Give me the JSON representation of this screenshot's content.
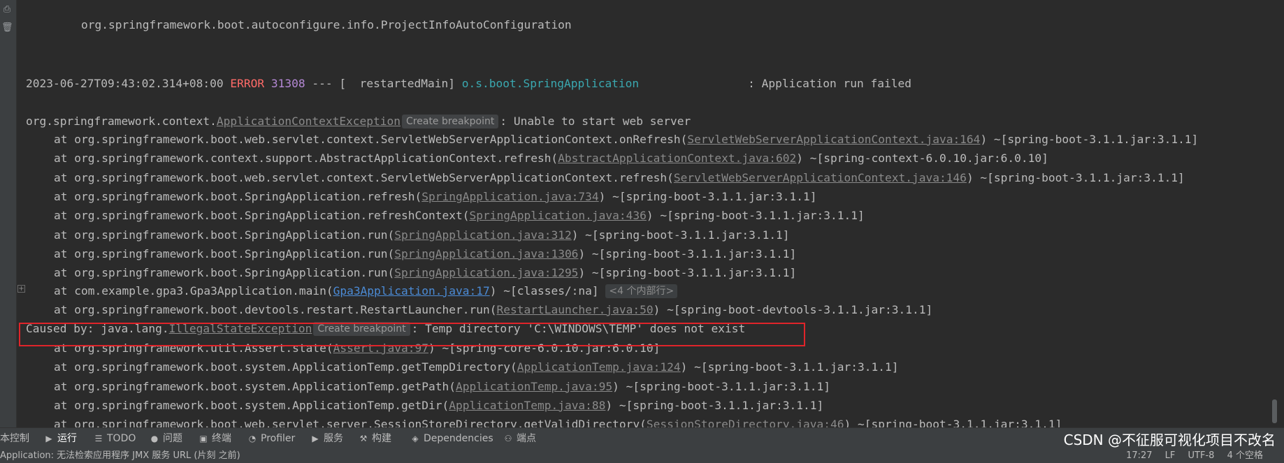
{
  "console": {
    "line_top": "org.springframework.boot.autoconfigure.info.ProjectInfoAutoConfiguration",
    "log": {
      "timestamp": "2023-06-27T09:43:02.314+08:00",
      "level": "ERROR",
      "pid": "31308",
      "sep": "--- [",
      "thread": "  restartedMain]",
      "logger": "o.s.boot.SpringApplication",
      "message": ": Application run failed"
    },
    "exception": {
      "prefix": "org.springframework.context.",
      "class": "ApplicationContextException",
      "breakpoint": "Create breakpoint",
      "message": ": Unable to start web server"
    },
    "trace1": [
      {
        "pre": "at org.springframework.boot.web.servlet.context.ServletWebServerApplicationContext.onRefresh(",
        "link": "ServletWebServerApplicationContext.java:164",
        "post": ") ~[spring-boot-3.1.1.jar:3.1.1]"
      },
      {
        "pre": "at org.springframework.context.support.AbstractApplicationContext.refresh(",
        "link": "AbstractApplicationContext.java:602",
        "post": ") ~[spring-context-6.0.10.jar:6.0.10]"
      },
      {
        "pre": "at org.springframework.boot.web.servlet.context.ServletWebServerApplicationContext.refresh(",
        "link": "ServletWebServerApplicationContext.java:146",
        "post": ") ~[spring-boot-3.1.1.jar:3.1.1]"
      },
      {
        "pre": "at org.springframework.boot.SpringApplication.refresh(",
        "link": "SpringApplication.java:734",
        "post": ") ~[spring-boot-3.1.1.jar:3.1.1]"
      },
      {
        "pre": "at org.springframework.boot.SpringApplication.refreshContext(",
        "link": "SpringApplication.java:436",
        "post": ") ~[spring-boot-3.1.1.jar:3.1.1]"
      },
      {
        "pre": "at org.springframework.boot.SpringApplication.run(",
        "link": "SpringApplication.java:312",
        "post": ") ~[spring-boot-3.1.1.jar:3.1.1]"
      },
      {
        "pre": "at org.springframework.boot.SpringApplication.run(",
        "link": "SpringApplication.java:1306",
        "post": ") ~[spring-boot-3.1.1.jar:3.1.1]"
      },
      {
        "pre": "at org.springframework.boot.SpringApplication.run(",
        "link": "SpringApplication.java:1295",
        "post": ") ~[spring-boot-3.1.1.jar:3.1.1]"
      }
    ],
    "main_line": {
      "pre": "at com.example.gpa3.Gpa3Application.main(",
      "link": "Gpa3Application.java:17",
      "post": ") ~[classes/:na] ",
      "hint": "<4 个内部行>"
    },
    "restart_line": {
      "pre": "at org.springframework.boot.devtools.restart.RestartLauncher.run(",
      "link": "RestartLauncher.java:50",
      "post": ") ~[spring-boot-devtools-3.1.1.jar:3.1.1]"
    },
    "caused": {
      "prefix": "Caused by: java.lang.",
      "class": "IllegalStateException",
      "breakpoint": "Create breakpoint",
      "message": ": Temp directory 'C:\\WINDOWS\\TEMP' does not exist"
    },
    "trace2": [
      {
        "pre": "at org.springframework.util.Assert.state(",
        "link": "Assert.java:97",
        "post": ") ~[spring-core-6.0.10.jar:6.0.10]"
      },
      {
        "pre": "at org.springframework.boot.system.ApplicationTemp.getTempDirectory(",
        "link": "ApplicationTemp.java:124",
        "post": ") ~[spring-boot-3.1.1.jar:3.1.1]"
      },
      {
        "pre": "at org.springframework.boot.system.ApplicationTemp.getPath(",
        "link": "ApplicationTemp.java:95",
        "post": ") ~[spring-boot-3.1.1.jar:3.1.1]"
      },
      {
        "pre": "at org.springframework.boot.system.ApplicationTemp.getDir(",
        "link": "ApplicationTemp.java:88",
        "post": ") ~[spring-boot-3.1.1.jar:3.1.1]"
      },
      {
        "pre": "at org.springframework.boot.web.servlet.server.SessionStoreDirectory.getValidDirectory(",
        "link": "SessionStoreDirectory.java:46",
        "post": ") ~[spring-boot-3.1.1.jar:3.1.1]"
      }
    ]
  },
  "toolbar": {
    "items": [
      {
        "label": "本控制",
        "icon": ""
      },
      {
        "label": "运行",
        "icon": "▶"
      },
      {
        "label": "TODO",
        "icon": "☰"
      },
      {
        "label": "问题",
        "icon": "●"
      },
      {
        "label": "终端",
        "icon": "▣"
      },
      {
        "label": "Profiler",
        "icon": "◔"
      },
      {
        "label": "服务",
        "icon": "▶"
      },
      {
        "label": "构建",
        "icon": "⚒"
      },
      {
        "label": "Dependencies",
        "icon": "◈"
      },
      {
        "label": "端点",
        "icon": "⚇"
      }
    ],
    "watermark": "CSDN @不征服可视化项目不改名"
  },
  "status": {
    "message": "Application: 无法检索应用程序 JMX 服务 URL (片刻 之前)",
    "time": "17:27",
    "line_sep": "LF",
    "encoding": "UTF-8",
    "indent": "4 个空格"
  }
}
